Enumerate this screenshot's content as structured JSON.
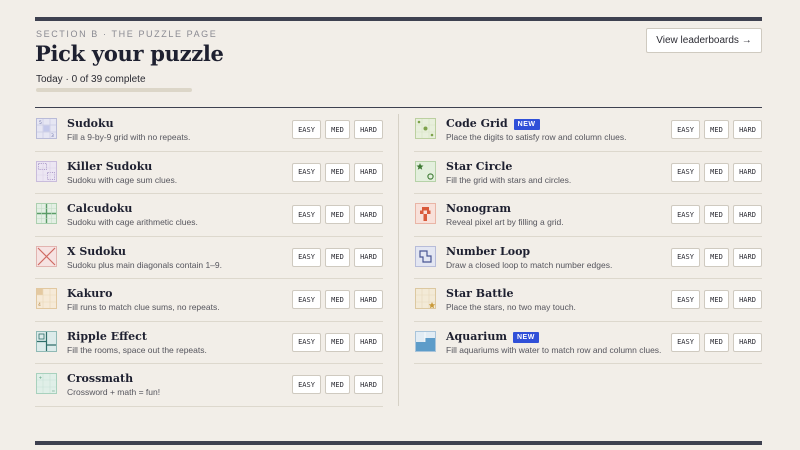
{
  "header": {
    "eyebrow": "SECTION B · THE PUZZLE PAGE",
    "title": "Pick your puzzle",
    "progress_text": "Today · 0 of 39 complete",
    "progress_fraction": 0,
    "leaderboards_label": "View leaderboards →"
  },
  "levels": {
    "easy": "EASY",
    "med": "MED",
    "hard": "HARD"
  },
  "new_label": "NEW",
  "left_puzzles": [
    {
      "name": "Sudoku",
      "desc": "Fill a 9-by-9 grid with no repeats.",
      "icon": "sudoku-icon"
    },
    {
      "name": "Killer Sudoku",
      "desc": "Sudoku with cage sum clues.",
      "icon": "killer-sudoku-icon"
    },
    {
      "name": "Calcudoku",
      "desc": "Sudoku with cage arithmetic clues.",
      "icon": "calcudoku-icon"
    },
    {
      "name": "X Sudoku",
      "desc": "Sudoku plus main diagonals contain 1–9.",
      "icon": "x-sudoku-icon"
    },
    {
      "name": "Kakuro",
      "desc": "Fill runs to match clue sums, no repeats.",
      "icon": "kakuro-icon"
    },
    {
      "name": "Ripple Effect",
      "desc": "Fill the rooms, space out the repeats.",
      "icon": "ripple-effect-icon"
    },
    {
      "name": "Crossmath",
      "desc": "Crossword + math = fun!",
      "icon": "crossmath-icon"
    }
  ],
  "right_puzzles": [
    {
      "name": "Code Grid",
      "desc": "Place the digits to satisfy row and column clues.",
      "icon": "code-grid-icon",
      "is_new": true
    },
    {
      "name": "Star Circle",
      "desc": "Fill the grid with stars and circles.",
      "icon": "star-circle-icon",
      "is_new": false
    },
    {
      "name": "Nonogram",
      "desc": "Reveal pixel art by filling a grid.",
      "icon": "nonogram-icon",
      "is_new": false
    },
    {
      "name": "Number Loop",
      "desc": "Draw a closed loop to match number edges.",
      "icon": "number-loop-icon",
      "is_new": false
    },
    {
      "name": "Star Battle",
      "desc": "Place the stars, no two may touch.",
      "icon": "star-battle-icon",
      "is_new": false
    },
    {
      "name": "Aquarium",
      "desc": "Fill aquariums with water to match row and column clues.",
      "icon": "aquarium-icon",
      "is_new": true
    }
  ],
  "colors": {
    "background": "#f2eee8",
    "ink": "#1e2030",
    "badge": "#3050d8"
  }
}
